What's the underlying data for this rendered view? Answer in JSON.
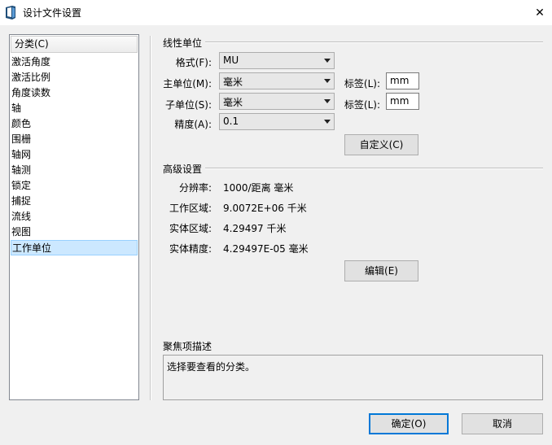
{
  "window": {
    "title": "设计文件设置",
    "close_glyph": "✕"
  },
  "categories": {
    "header": "分类(C)",
    "items": [
      "激活角度",
      "激活比例",
      "角度读数",
      "轴",
      "颜色",
      "围栅",
      "轴网",
      "轴测",
      "锁定",
      "捕捉",
      "流线",
      "视图",
      "工作单位"
    ],
    "selected": "工作单位"
  },
  "linear_units": {
    "title": "线性单位",
    "format_label": "格式(F):",
    "format_value": "MU",
    "master_label": "主单位(M):",
    "master_value": "毫米",
    "master_tag_label": "标签(L):",
    "master_tag_value": "mm",
    "sub_label": "子单位(S):",
    "sub_value": "毫米",
    "sub_tag_label": "标签(L):",
    "sub_tag_value": "mm",
    "precision_label": "精度(A):",
    "precision_value": "0.1",
    "custom_button": "自定义(C)"
  },
  "advanced": {
    "title": "高级设置",
    "resolution_label": "分辨率:",
    "resolution_value": "1000/距离 毫米",
    "working_area_label": "工作区域:",
    "working_area_value": "9.0072E+06 千米",
    "solid_area_label": "实体区域:",
    "solid_area_value": "4.29497 千米",
    "solid_precision_label": "实体精度:",
    "solid_precision_value": "4.29497E-05 毫米",
    "edit_button": "编辑(E)"
  },
  "focus_description": {
    "title": "聚焦项描述",
    "text": "选择要查看的分类。"
  },
  "footer": {
    "ok_button": "确定(O)",
    "cancel_button": "取消"
  }
}
